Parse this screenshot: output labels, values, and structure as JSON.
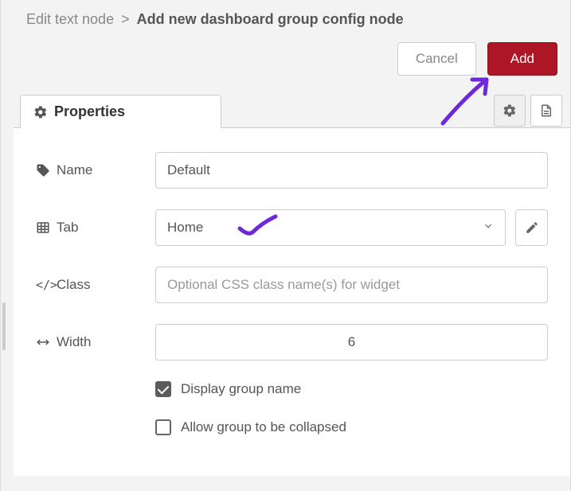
{
  "breadcrumb": {
    "parent": "Edit text node",
    "current": "Add new dashboard group config node"
  },
  "actions": {
    "cancel": "Cancel",
    "add": "Add"
  },
  "tabs": {
    "properties": "Properties"
  },
  "form": {
    "name": {
      "label": "Name",
      "value": "Default"
    },
    "tab": {
      "label": "Tab",
      "value": "Home"
    },
    "class": {
      "label": "Class",
      "placeholder": "Optional CSS class name(s) for widget",
      "value": ""
    },
    "width": {
      "label": "Width",
      "value": "6"
    },
    "displayGroupName": {
      "label": "Display group name",
      "checked": true
    },
    "allowCollapse": {
      "label": "Allow group to be collapsed",
      "checked": false
    }
  }
}
